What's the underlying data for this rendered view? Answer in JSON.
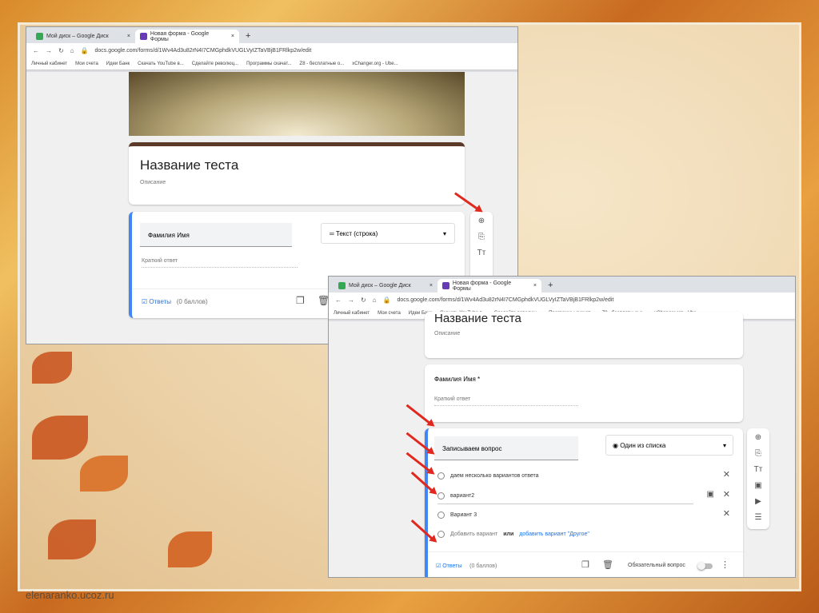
{
  "browser": {
    "tabs": [
      {
        "label": "Мой диск – Google Диск"
      },
      {
        "label": "Новая форма - Google Формы"
      }
    ],
    "new_tab": "+",
    "close": "×",
    "url": "docs.google.com/forms/d/1Wv4Ad3u82rN4I7CMGphdkVUGLVyIZTaVBjB1FRlkp2w/edit",
    "bookmarks": [
      "Личный кабинет",
      "Мои счета",
      "Идеи Банк",
      "Скачать YouTube в...",
      "Сделайте революц...",
      "Программы скачат...",
      "Z8 - бесплатные о...",
      "xChanger.org - Ube..."
    ]
  },
  "form1": {
    "title": "Название теста",
    "description": "Описание",
    "question": "Фамилия Имя",
    "type": "Текст (строка)",
    "short_answer": "Краткий ответ",
    "answers": "Ответы",
    "points": "(0 баллов)"
  },
  "form2": {
    "title": "Название теста",
    "description": "Описание",
    "q1": "Фамилия Имя *",
    "q1_answer": "Краткий ответ",
    "question": "Записываем вопрос",
    "type": "Один из списка",
    "options": [
      "даем несколько вариантов ответа",
      "вариант2",
      "Вариант 3"
    ],
    "add_option": "Добавить вариант",
    "or": "или",
    "add_other": "добавить вариант \"Другое\"",
    "answers": "Ответы",
    "points": "(0 баллов)",
    "required": "Обязательный вопрос"
  },
  "footer": "elenaranko.ucoz.ru",
  "colors": {
    "accent": "#4285f4",
    "arrow": "#e0281e",
    "form_header": "#5b3a29"
  }
}
